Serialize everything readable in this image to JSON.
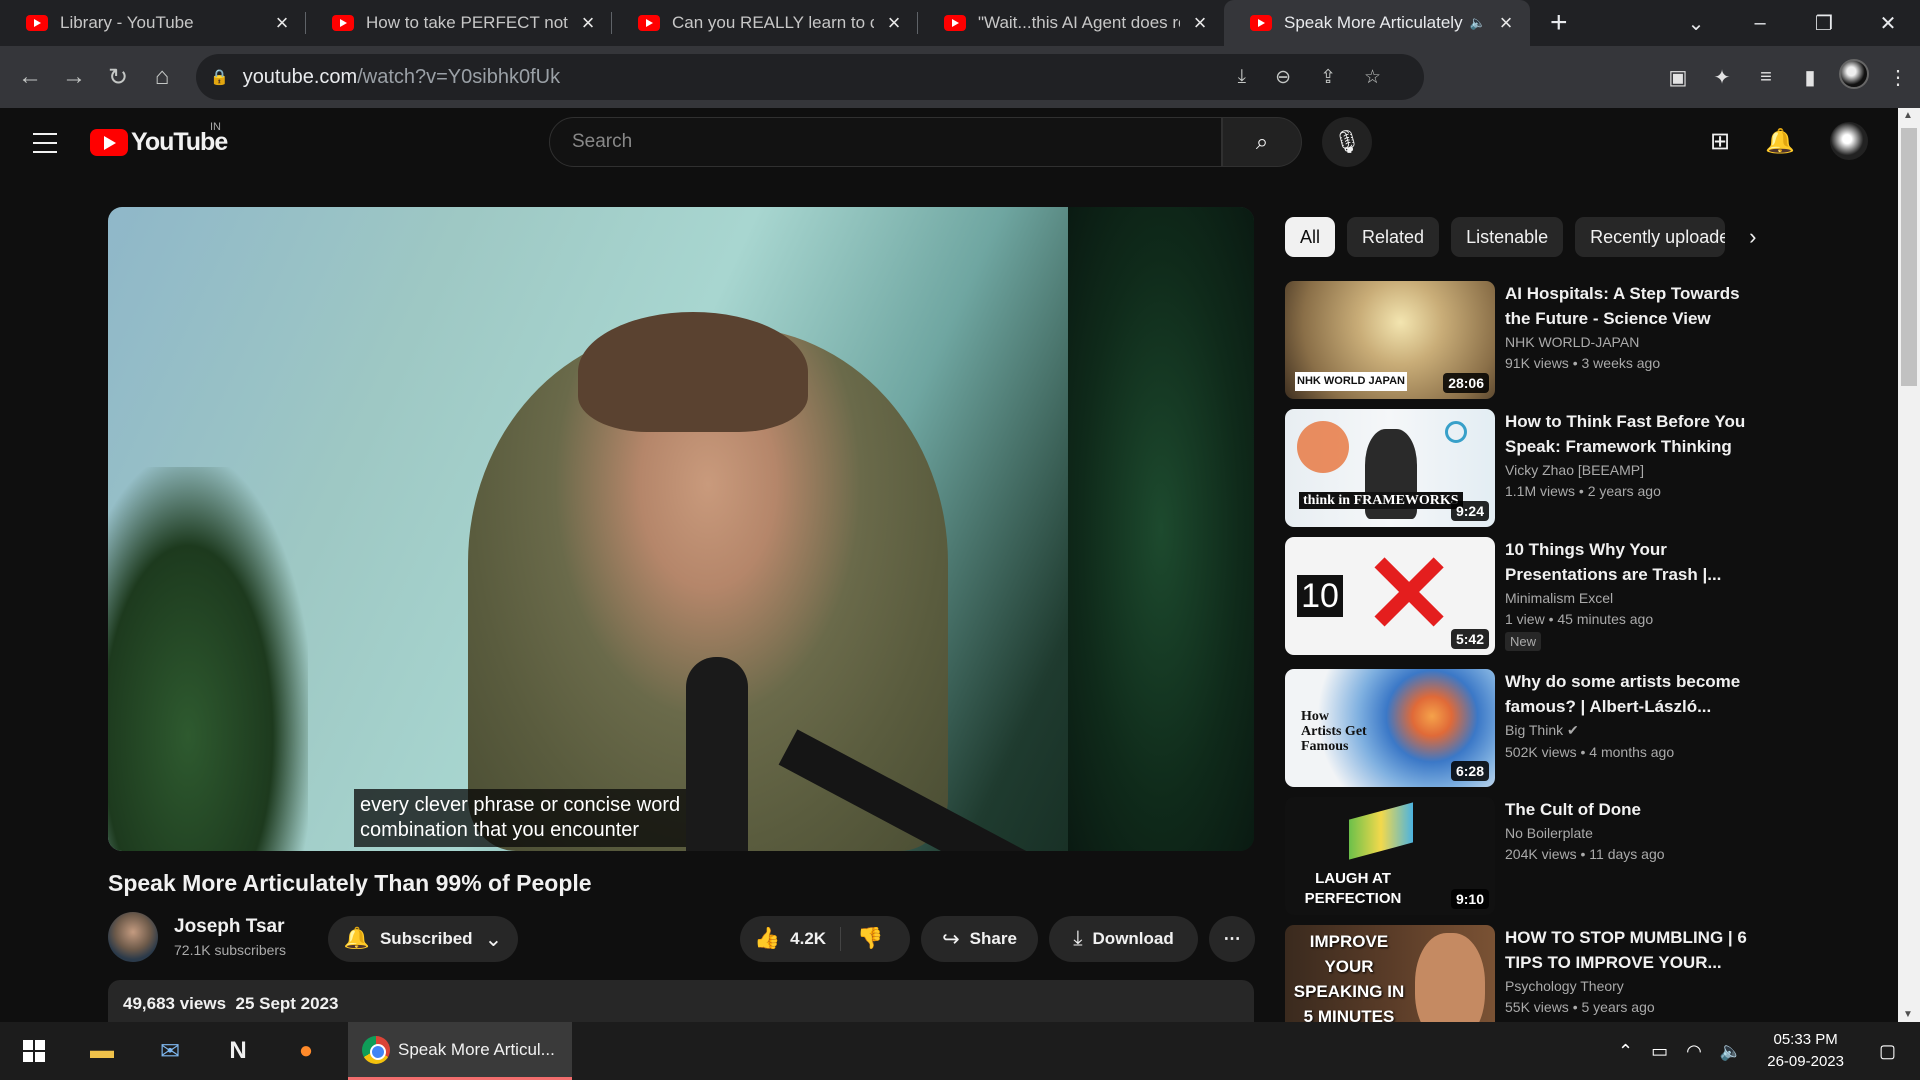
{
  "browser": {
    "tabs": [
      {
        "title": "Library - YouTube"
      },
      {
        "title": "How to take PERFECT notes w"
      },
      {
        "title": "Can you REALLY learn to code"
      },
      {
        "title": "\"Wait...this AI Agent does rese"
      },
      {
        "title": "Speak More Articulately T",
        "active": true
      }
    ],
    "url_host": "youtube.com",
    "url_path": "/watch?v=Y0sibhk0fUk"
  },
  "youtube": {
    "logo_text": "YouTube",
    "country_code": "IN",
    "search_placeholder": "Search"
  },
  "video": {
    "caption_line1": "every clever phrase or concise word",
    "caption_line2": "combination that you encounter",
    "title": "Speak More Articulately Than 99% of People",
    "channel": "Joseph Tsar",
    "subscribers": "72.1K subscribers",
    "subscribed_label": "Subscribed",
    "likes": "4.2K",
    "share_label": "Share",
    "download_label": "Download",
    "views": "49,683 views",
    "date": "25 Sept 2023"
  },
  "chips": [
    "All",
    "Related",
    "Listenable",
    "Recently uploade"
  ],
  "recommendations": [
    {
      "title": "AI Hospitals: A Step Towards the Future - Science View",
      "channel": "NHK WORLD-JAPAN",
      "views": "91K views",
      "age": "3 weeks ago",
      "duration": "28:06",
      "thumb_text": "NHK WORLD JAPAN"
    },
    {
      "title": "How to Think Fast Before You Speak: Framework Thinking",
      "channel": "Vicky Zhao [BEEAMP]",
      "views": "1.1M views",
      "age": "2 years ago",
      "duration": "9:24",
      "thumb_text": "think in FRAMEWORKS"
    },
    {
      "title": "10 Things Why Your Presentations are Trash |...",
      "channel": "Minimalism Excel",
      "views": "1 view",
      "age": "45 minutes ago",
      "duration": "5:42",
      "badge": "New",
      "thumb_text": "10"
    },
    {
      "title": "Why do some artists become famous? | Albert-László...",
      "channel": "Big Think",
      "views": "502K views",
      "age": "4 months ago",
      "duration": "6:28",
      "thumb_text": "How Artists Get Famous"
    },
    {
      "title": "The Cult of Done",
      "channel": "No Boilerplate",
      "views": "204K views",
      "age": "11 days ago",
      "duration": "9:10",
      "thumb_text": "LAUGH AT PERFECTION"
    },
    {
      "title": "HOW TO STOP MUMBLING | 6 TIPS TO IMPROVE YOUR...",
      "channel": "Psychology Theory",
      "views": "55K views",
      "age": "5 years ago",
      "duration": "",
      "thumb_text": "IMPROVE YOUR SPEAKING IN 5 MINUTES"
    }
  ],
  "taskbar": {
    "chrome_label": "Speak More Articul...",
    "time": "05:33 PM",
    "date": "26-09-2023"
  },
  "colors": {
    "accent": "#ff0000",
    "background": "#0f0f0f"
  }
}
